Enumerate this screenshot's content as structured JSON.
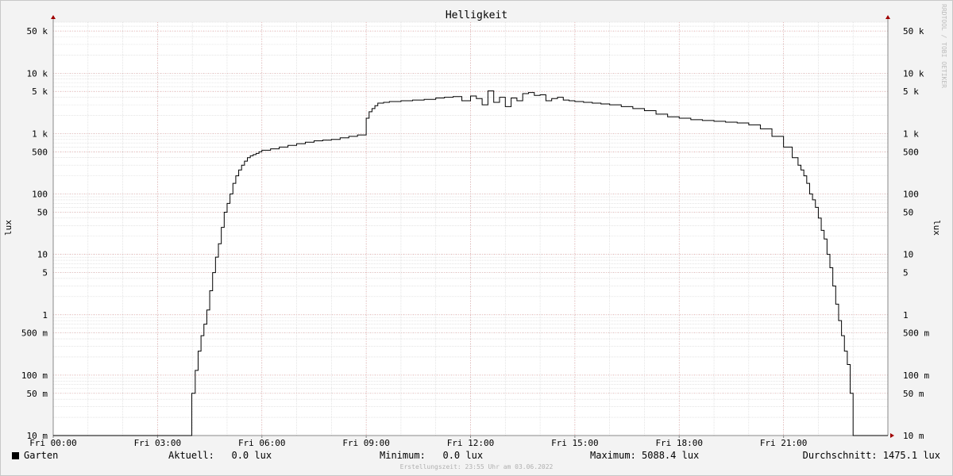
{
  "chart_data": {
    "type": "line",
    "title": "Helligkeit",
    "ylabel": "lux",
    "y_scale": "log",
    "ylim": [
      0.01,
      70000
    ],
    "x_range": [
      "00:00",
      "24:00"
    ],
    "x_ticks": [
      "Fri 00:00",
      "Fri 03:00",
      "Fri 06:00",
      "Fri 09:00",
      "Fri 12:00",
      "Fri 15:00",
      "Fri 18:00",
      "Fri 21:00"
    ],
    "y_ticks": [
      "10 m",
      "50 m",
      "100 m",
      "500 m",
      "1",
      "5",
      "10",
      "50",
      "100",
      "500",
      "1 k",
      "5 k",
      "10 k",
      "50 k"
    ],
    "grid": true,
    "series": [
      {
        "name": "Garten",
        "color": "#000000",
        "x": [
          "00:00",
          "03:59",
          "04:05",
          "04:10",
          "04:15",
          "04:20",
          "04:25",
          "04:30",
          "04:35",
          "04:40",
          "04:45",
          "04:50",
          "04:55",
          "05:00",
          "05:05",
          "05:10",
          "05:15",
          "05:20",
          "05:25",
          "05:30",
          "05:35",
          "05:40",
          "05:45",
          "05:50",
          "05:55",
          "06:00",
          "06:15",
          "06:30",
          "06:45",
          "07:00",
          "07:15",
          "07:30",
          "07:45",
          "08:00",
          "08:15",
          "08:30",
          "08:45",
          "09:00",
          "09:05",
          "09:10",
          "09:15",
          "09:20",
          "09:30",
          "09:40",
          "10:00",
          "10:20",
          "10:40",
          "11:00",
          "11:15",
          "11:30",
          "11:45",
          "12:00",
          "12:10",
          "12:20",
          "12:30",
          "12:40",
          "12:50",
          "13:00",
          "13:10",
          "13:20",
          "13:30",
          "13:40",
          "13:50",
          "14:00",
          "14:10",
          "14:20",
          "14:30",
          "14:40",
          "14:50",
          "15:00",
          "15:15",
          "15:30",
          "15:45",
          "16:00",
          "16:20",
          "16:40",
          "17:00",
          "17:20",
          "17:40",
          "18:00",
          "18:20",
          "18:40",
          "19:00",
          "19:20",
          "19:40",
          "20:00",
          "20:20",
          "20:40",
          "21:00",
          "21:15",
          "21:25",
          "21:30",
          "21:35",
          "21:40",
          "21:45",
          "21:50",
          "21:55",
          "22:00",
          "22:05",
          "22:10",
          "22:15",
          "22:20",
          "22:25",
          "22:30",
          "22:35",
          "22:40",
          "22:45",
          "22:50",
          "22:55",
          "23:00",
          "23:05",
          "23:10",
          "23:15",
          "23:20",
          "23:25",
          "23:30",
          "23:35",
          "23:40",
          "23:45",
          "23:50",
          "23:55"
        ],
        "values": [
          0.01,
          0.05,
          0.12,
          0.25,
          0.45,
          0.7,
          1.2,
          2.5,
          5,
          9,
          15,
          28,
          50,
          70,
          100,
          150,
          200,
          250,
          300,
          350,
          400,
          430,
          450,
          470,
          500,
          530,
          560,
          600,
          640,
          680,
          720,
          760,
          780,
          800,
          850,
          900,
          950,
          1800,
          2300,
          2600,
          2900,
          3200,
          3300,
          3400,
          3500,
          3600,
          3700,
          3900,
          4000,
          4100,
          3500,
          4200,
          3800,
          3000,
          5088,
          3300,
          4000,
          2800,
          3900,
          3500,
          4600,
          4800,
          4300,
          4400,
          3500,
          3800,
          4000,
          3600,
          3500,
          3400,
          3300,
          3200,
          3100,
          3000,
          2800,
          2600,
          2400,
          2100,
          1900,
          1800,
          1700,
          1650,
          1600,
          1550,
          1500,
          1400,
          1200,
          900,
          600,
          400,
          300,
          250,
          200,
          150,
          100,
          80,
          60,
          40,
          25,
          18,
          10,
          6,
          3,
          1.5,
          0.8,
          0.45,
          0.25,
          0.15,
          0.05,
          0.01,
          0.01,
          0.01,
          0.01,
          0.01,
          0.01,
          0.01,
          0.01,
          0.01,
          0.01,
          0.01,
          0.01
        ]
      }
    ]
  },
  "legend": {
    "series_name": "Garten",
    "current": "Aktuell:   0.0 lux",
    "minimum": "Minimum:   0.0 lux",
    "maximum": "Maximum: 5088.4 lux",
    "average": "Durchschnitt: 1475.1 lux"
  },
  "credit": "RRDTOOL / TOBI OETIKER",
  "created": "Erstellungszeit: 23:55 Uhr am 03.06.2022"
}
